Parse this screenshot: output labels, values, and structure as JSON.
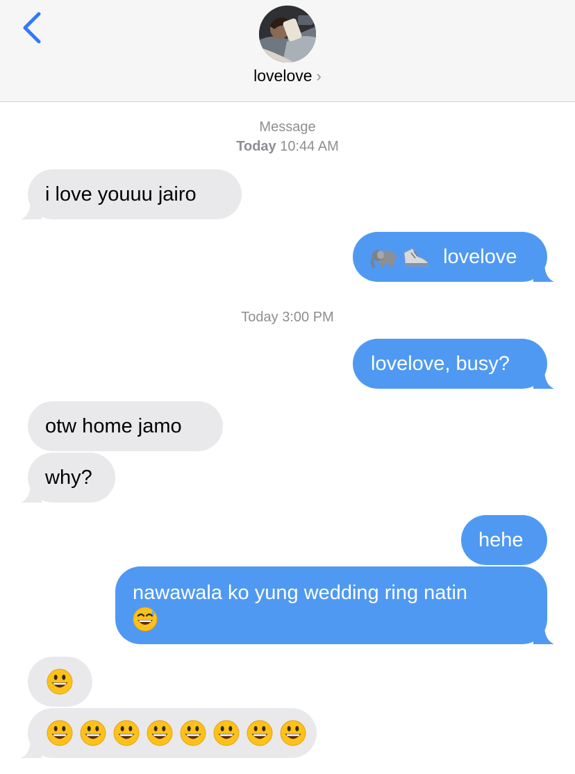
{
  "header": {
    "contact_name": "lovelove",
    "chevron": "›"
  },
  "timestamps": {
    "first_label": "Message",
    "first_day": "Today",
    "first_time": "10:44 AM",
    "second": "Today 3:00 PM"
  },
  "messages": [
    {
      "from": "them",
      "text": "i love youuu jairo"
    },
    {
      "from": "me",
      "text": "lovelove",
      "icons": [
        "elephant-icon",
        "sneaker-icon"
      ]
    },
    {
      "from": "me",
      "text": "lovelove, busy?"
    },
    {
      "from": "them",
      "text": "otw home jamo"
    },
    {
      "from": "them",
      "text": "why?"
    },
    {
      "from": "me",
      "text": "hehe"
    },
    {
      "from": "me",
      "text": "nawawala ko yung wedding ring natin",
      "icons": [
        "grinning-sweat-emoji"
      ]
    },
    {
      "from": "them",
      "text": "",
      "icons": [
        "smiley-emoji"
      ]
    },
    {
      "from": "them",
      "text": "",
      "icons": [
        "smiley-emoji",
        "smiley-emoji",
        "smiley-emoji",
        "smiley-emoji",
        "smiley-emoji",
        "smiley-emoji",
        "smiley-emoji",
        "smiley-emoji"
      ]
    }
  ],
  "colors": {
    "outgoing": "#4f99f2",
    "incoming": "#e9e9eb",
    "accent": "#3478f6"
  }
}
